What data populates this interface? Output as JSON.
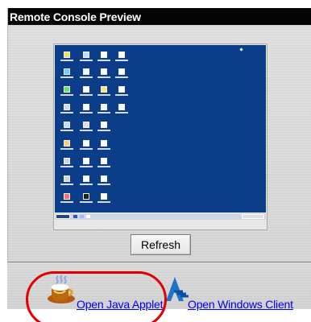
{
  "panel": {
    "title": "Remote Console Preview"
  },
  "controls": {
    "refresh_label": "Refresh"
  },
  "clients": {
    "java_label": "Open Java Applet",
    "windows_label": "Open Windows Client"
  },
  "icons": {
    "java": "coffee-cup-icon",
    "windows": "windows-client-icon"
  },
  "colors": {
    "title_bar": "#050505",
    "desktop": "#0b3d88",
    "link": "#0000ee",
    "annotation": "#e00000"
  }
}
